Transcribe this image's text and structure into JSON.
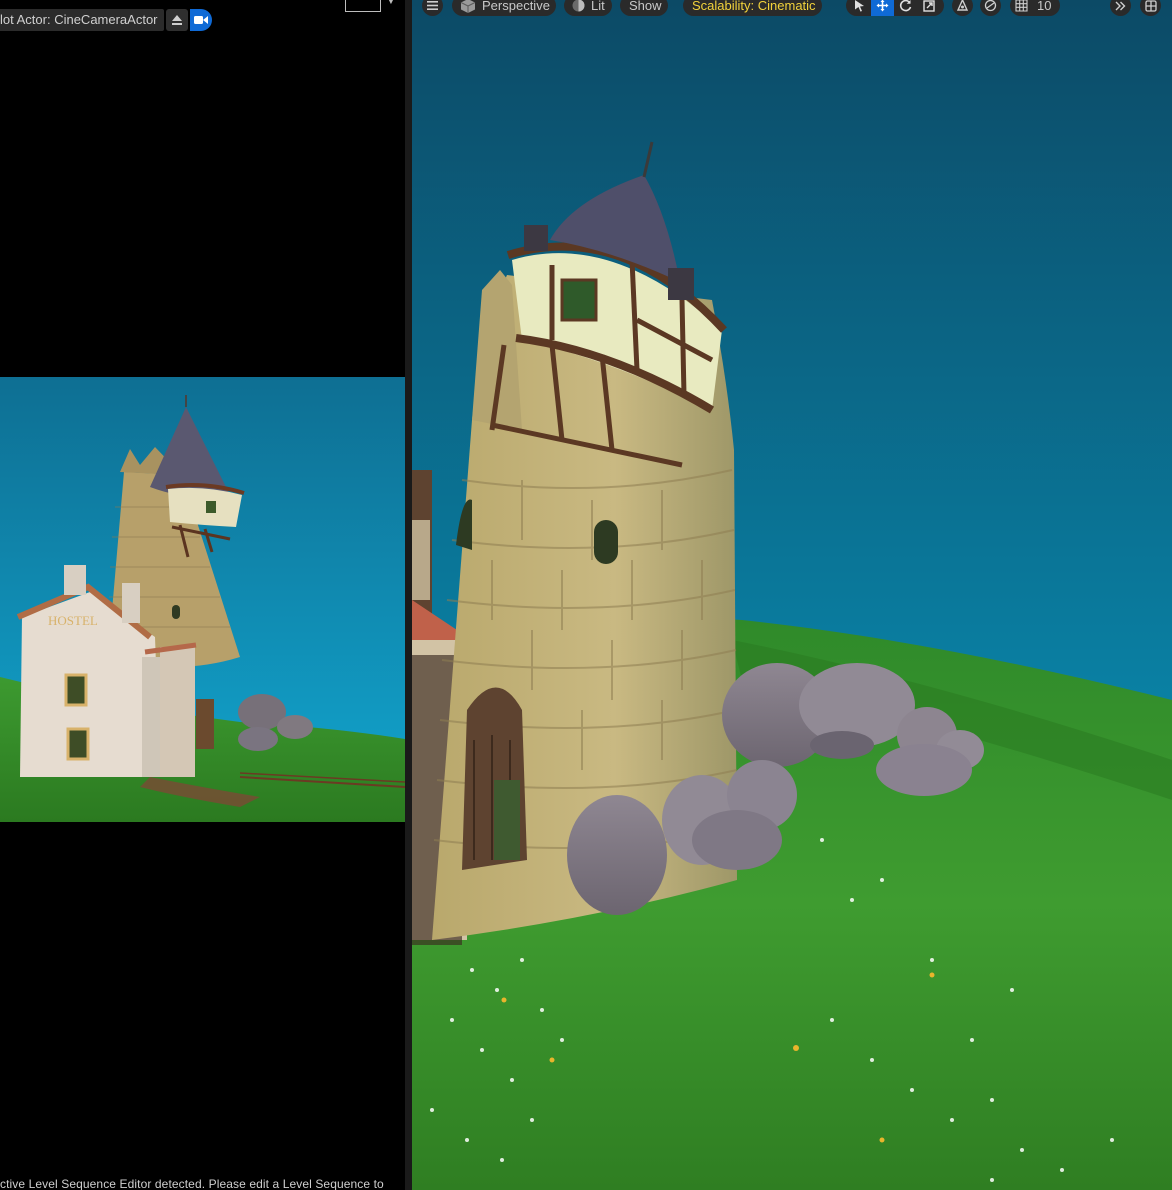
{
  "left_viewport": {
    "pilot_label": "lot Actor: CineCameraActor",
    "eject_icon": "eject-icon",
    "camera_icon": "video-camera-icon",
    "status_message": "ctive Level Sequence Editor detected. Please edit a Level Sequence to"
  },
  "viewport_toolbar": {
    "menu_icon": "hamburger-menu-icon",
    "perspective_label": "Perspective",
    "lit_label": "Lit",
    "show_label": "Show",
    "scalability_label": "Scalability: Cinematic",
    "grid_snap_value": "10",
    "tools": [
      "select-icon",
      "translate-icon",
      "rotate-icon",
      "scale-icon"
    ],
    "more_icon": "double-chevron-right-icon",
    "layout_icon": "viewport-layout-icon"
  },
  "scene_text": {
    "hostel_sign": "HOSTEL"
  },
  "colors": {
    "accent_blue": "#0f6ad6",
    "scalability_yellow": "#f2d23b",
    "sky_top": "#0c4f6e",
    "sky_bottom": "#0b8fb3",
    "grass": "#3c9a2a"
  }
}
